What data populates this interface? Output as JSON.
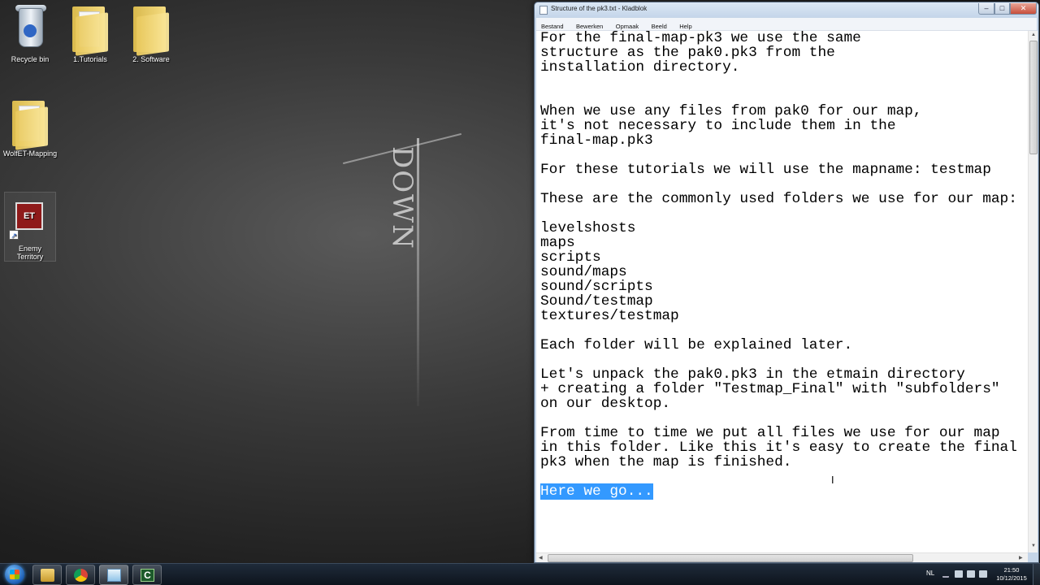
{
  "desktop": {
    "icons": [
      {
        "label": "Recycle bin",
        "icon": "recycle-bin-icon"
      },
      {
        "label": "1.Tutorials",
        "icon": "folder-icon"
      },
      {
        "label": "2. Software",
        "icon": "folder-icon"
      },
      {
        "label": "WolfET-Mapping",
        "icon": "folder-icon"
      },
      {
        "label": "Enemy Territory",
        "icon": "enemy-territory-icon"
      }
    ],
    "wallpaper_text": "DOWN"
  },
  "notepad": {
    "title": "Structure of the pk3.txt - Kladblok",
    "controls": {
      "minimize": "–",
      "maximize": "□",
      "close": "✕"
    },
    "menu": [
      "Bestand",
      "Bewerken",
      "Opmaak",
      "Beeld",
      "Help"
    ],
    "lines": [
      "For the final-map-pk3 we use the same",
      "structure as the pak0.pk3 from the",
      "installation directory.",
      "",
      "",
      "When we use any files from pak0 for our map,",
      "it's not necessary to include them in the",
      "final-map.pk3",
      "",
      "For these tutorials we will use the mapname: testmap",
      "",
      "These are the commonly used folders we use for our map:",
      "",
      "levelshosts",
      "maps",
      "scripts",
      "sound/maps",
      "sound/scripts",
      "Sound/testmap",
      "textures/testmap",
      "",
      "Each folder will be explained later.",
      "",
      "Let's unpack the pak0.pk3 in the etmain directory",
      "+ creating a folder \"Testmap_Final\" with \"subfolders\"",
      "on our desktop.",
      "",
      "From time to time we put all files we use for our map",
      "in this folder. Like this it's easy to create the final",
      "pk3 when the map is finished.",
      ""
    ],
    "selected_line": "Here we go..."
  },
  "taskbar": {
    "pinned": [
      "explorer-icon",
      "chrome-icon",
      "notepad-icon",
      "camtasia-icon"
    ],
    "language": "NL",
    "clock_time": "21:50",
    "clock_date": "10/12/2015"
  },
  "colors": {
    "selection": "#3399ff",
    "window_frame": "#c5d5e8",
    "taskbar": "#0d141d"
  }
}
